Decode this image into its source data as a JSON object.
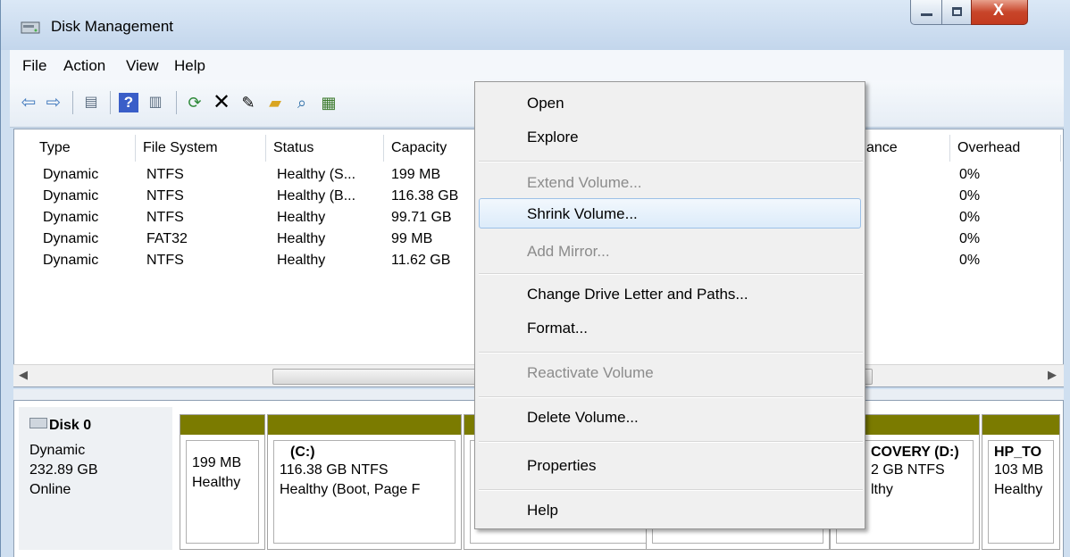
{
  "window": {
    "title": "Disk Management"
  },
  "menubar": [
    "File",
    "Action",
    "View",
    "Help"
  ],
  "toolbar": [
    "back-icon",
    "forward-icon",
    "console-tree-icon",
    "help-icon",
    "action-pane-icon",
    "refresh-icon",
    "delete-icon",
    "properties-icon",
    "open-icon",
    "explore-icon",
    "rescan-icon"
  ],
  "volume_list": {
    "columns": [
      "Type",
      "File System",
      "Status",
      "Capacity",
      "ance",
      "Overhead"
    ],
    "rows": [
      {
        "type": "Dynamic",
        "fs": "NTFS",
        "status": "Healthy (S...",
        "capacity": "199 MB",
        "overhead": "0%"
      },
      {
        "type": "Dynamic",
        "fs": "NTFS",
        "status": "Healthy (B...",
        "capacity": "116.38 GB",
        "overhead": "0%"
      },
      {
        "type": "Dynamic",
        "fs": "NTFS",
        "status": "Healthy",
        "capacity": "99.71 GB",
        "overhead": "0%"
      },
      {
        "type": "Dynamic",
        "fs": "FAT32",
        "status": "Healthy",
        "capacity": "99 MB",
        "overhead": "0%"
      },
      {
        "type": "Dynamic",
        "fs": "NTFS",
        "status": "Healthy",
        "capacity": "11.62 GB",
        "overhead": "0%"
      }
    ]
  },
  "disk": {
    "name": "Disk 0",
    "type": "Dynamic",
    "size": "232.89 GB",
    "status": "Online",
    "partitions": [
      {
        "line1": "",
        "line2": "199 MB",
        "line3": "Healthy"
      },
      {
        "line1": "(C:)",
        "line2": "116.38 GB NTFS",
        "line3": "Healthy (Boot, Page F"
      },
      {
        "line1": "COVERY  (D:)",
        "line2": "2 GB NTFS",
        "line3": "lthy"
      },
      {
        "line1": "HP_TO",
        "line2": "103 MB",
        "line3": "Healthy"
      }
    ]
  },
  "context_menu": {
    "items": [
      {
        "label": "Open",
        "enabled": true
      },
      {
        "label": "Explore",
        "enabled": true
      },
      {
        "label": "Extend Volume...",
        "enabled": false
      },
      {
        "label": "Shrink Volume...",
        "enabled": true,
        "highlighted": true
      },
      {
        "label": "Add Mirror...",
        "enabled": false
      },
      {
        "label": "Change Drive Letter and Paths...",
        "enabled": true
      },
      {
        "label": "Format...",
        "enabled": true
      },
      {
        "label": "Reactivate Volume",
        "enabled": false
      },
      {
        "label": "Delete Volume...",
        "enabled": true
      },
      {
        "label": "Properties",
        "enabled": true
      },
      {
        "label": "Help",
        "enabled": true
      }
    ]
  },
  "colors": {
    "partition_bar": "#7b7b00",
    "highlight_border": "#9dc1e7",
    "disabled_text": "#8b8b8b"
  }
}
